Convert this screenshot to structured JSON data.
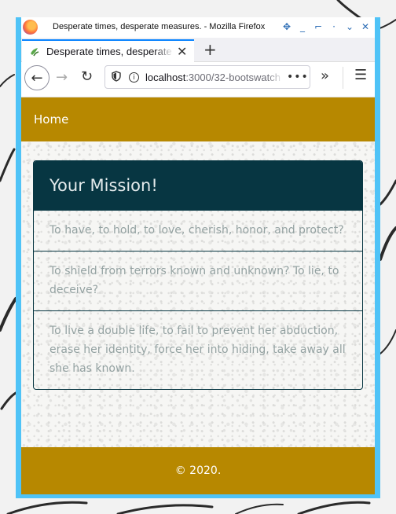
{
  "window": {
    "title": "Desperate times, desperate measures. - Mozilla Firefox"
  },
  "tab": {
    "label": "Desperate times, desperate measures.",
    "close": "✕"
  },
  "toolbar": {
    "new_tab": "+",
    "url_host": "localhost",
    "url_rest": ":3000/32-bootswatch",
    "page_actions": "•••",
    "overflow": "»",
    "menu": "☰"
  },
  "page": {
    "nav": {
      "home_label": "Home"
    },
    "card": {
      "title": "Your Mission!",
      "items": [
        "To have, to hold, to love, cherish, honor, and protect?",
        "To shield from terrors known and unknown? To lie, to deceive?",
        "To live a double life, to fail to prevent her abduction, erase her identity, force her into hiding, take away all she has known."
      ]
    },
    "footer": {
      "text": "© 2020."
    }
  },
  "colors": {
    "brand": "#b78800",
    "card_header": "#073642",
    "list_text": "#93a1a1",
    "window_border": "#4fc3f7"
  }
}
